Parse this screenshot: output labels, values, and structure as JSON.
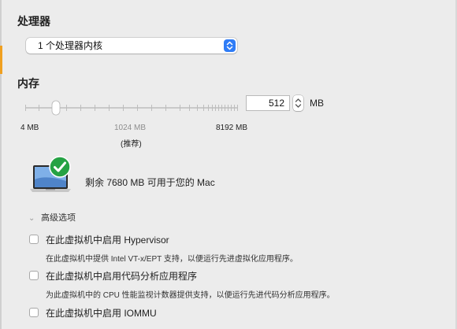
{
  "processor": {
    "title": "处理器",
    "selected_option": "1 个处理器内核"
  },
  "memory": {
    "title": "内存",
    "value": "512",
    "unit": "MB",
    "slider_level_mb": 512,
    "slider_min_mb": 4,
    "slider_max_mb": 8192,
    "tick_min_label": "4 MB",
    "tick_recommended_label": "1024 MB",
    "tick_recommended_note": "(推荐)",
    "tick_max_label": "8192 MB"
  },
  "availability": {
    "text": "剩余 7680 MB 可用于您的 Mac",
    "status_icon": "green-checkmark-icon"
  },
  "advanced": {
    "label": "高级选项",
    "options": [
      {
        "label": "在此虚拟机中启用 Hypervisor",
        "description": "在此虚拟机中提供 Intel VT-x/EPT 支持，以便运行先进虚拟化应用程序。",
        "checked": false
      },
      {
        "label": "在此虚拟机中启用代码分析应用程序",
        "description": "为此虚拟机中的 CPU 性能监视计数器提供支持，以便运行先进代码分析应用程序。",
        "checked": false
      },
      {
        "label": "在此虚拟机中启用 IOMMU",
        "checked": false
      }
    ]
  },
  "colors": {
    "accent_blue": "#2f7cf6",
    "check_green": "#25a244",
    "background": "#ececec"
  }
}
